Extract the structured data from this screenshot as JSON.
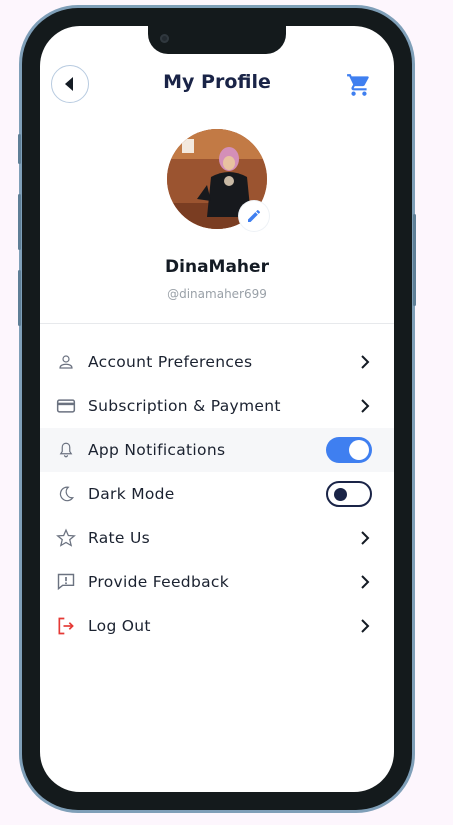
{
  "header": {
    "title": "My Profile"
  },
  "profile": {
    "name": "DinaMaher",
    "handle": "@dinamaher699"
  },
  "menu": [
    {
      "label": "Account Preferences",
      "icon": "person-icon"
    },
    {
      "label": "Subscription & Payment",
      "icon": "credit-card-icon"
    },
    {
      "label": "App Notifications",
      "icon": "bell-icon",
      "toggle": "on"
    },
    {
      "label": "Dark Mode",
      "icon": "moon-icon",
      "toggle": "off"
    },
    {
      "label": "Rate Us",
      "icon": "star-icon"
    },
    {
      "label": "Provide Feedback",
      "icon": "feedback-icon"
    },
    {
      "label": "Log Out",
      "icon": "logout-icon"
    }
  ],
  "colors": {
    "accent": "#3f7ff0",
    "navy": "#1a2447",
    "logout": "#e53935"
  }
}
